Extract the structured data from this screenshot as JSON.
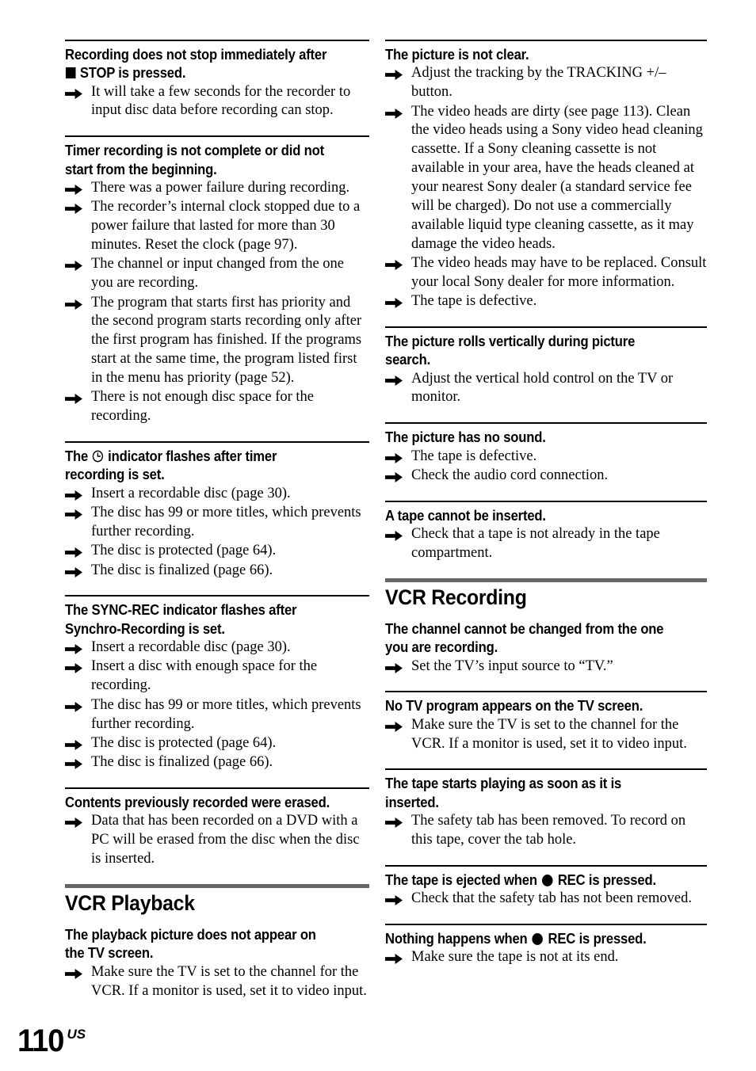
{
  "page": {
    "folio_number": "110",
    "folio_suffix": "US"
  },
  "left_column": {
    "blocks": [
      {
        "kind": "sub",
        "rule": "thin",
        "heading_parts": [
          {
            "type": "text",
            "value": "Recording does not stop immediately after "
          },
          {
            "type": "icon",
            "value": "stop-square-icon"
          },
          {
            "type": "text",
            "value": " STOP is pressed."
          }
        ],
        "heading_text": "Recording does not stop immediately after ■ STOP is pressed.",
        "bullets": [
          "It will take a few seconds for the recorder to input disc data before recording can stop."
        ]
      },
      {
        "kind": "sub",
        "rule": "thin",
        "heading_text": "Timer recording is not complete or did not start from the beginning.",
        "bullets": [
          "There was a power failure during recording.",
          "The recorder’s internal clock stopped due to a power failure that lasted for more than 30 minutes. Reset the clock (page 97).",
          "The channel or input changed from the one you are recording.",
          "The program that starts first has priority and the second program starts recording only after the first program has finished. If the programs start at the same time, the program listed first in the menu has priority (page 52).",
          "There is not enough disc space for the recording."
        ]
      },
      {
        "kind": "sub",
        "rule": "thin",
        "heading_parts": [
          {
            "type": "text",
            "value": "The "
          },
          {
            "type": "icon",
            "value": "timer-clock-icon"
          },
          {
            "type": "text",
            "value": " indicator flashes after timer recording is set."
          }
        ],
        "heading_text": "The ⊙ indicator flashes after timer recording is set.",
        "bullets": [
          "Insert a recordable disc (page 30).",
          "The disc has 99 or more titles, which prevents further recording.",
          "The disc is protected (page 64).",
          "The disc is finalized (page 66)."
        ]
      },
      {
        "kind": "sub",
        "rule": "thin",
        "heading_text": "The SYNC-REC indicator flashes after Synchro-Recording is set.",
        "bullets": [
          "Insert a recordable disc (page 30).",
          "Insert a disc with enough space for the recording.",
          "The disc has 99 or more titles, which prevents further recording.",
          "The disc is protected (page 64).",
          "The disc is finalized (page 66)."
        ]
      },
      {
        "kind": "sub",
        "rule": "thin",
        "heading_text": "Contents previously recorded were erased.",
        "bullets": [
          "Data that has been recorded on a DVD with a PC will be erased from the disc when the disc is inserted."
        ]
      },
      {
        "kind": "section",
        "rule": "section",
        "heading_text": "VCR Playback",
        "bullets": []
      },
      {
        "kind": "sub",
        "rule": "none",
        "heading_text": "The playback picture does not appear on the TV screen.",
        "bullets": [
          "Make sure the TV is set to the channel for the VCR. If a monitor is used, set it to video input."
        ]
      }
    ]
  },
  "right_column": {
    "blocks": [
      {
        "kind": "sub",
        "rule": "thin",
        "heading_text": "The picture is not clear.",
        "bullets": [
          "Adjust the tracking by the TRACKING +/– button.",
          "The video heads are dirty (see page 113). Clean the video heads using a Sony video head cleaning cassette. If a Sony cleaning cassette is not available in your area, have the heads cleaned at your nearest Sony dealer (a standard service fee will be charged). Do not use a commercially available liquid type cleaning cassette, as it may damage the video heads.",
          "The video heads may have to be replaced. Consult your local Sony dealer for more information.",
          "The tape is defective."
        ]
      },
      {
        "kind": "sub",
        "rule": "thin",
        "heading_text": "The picture rolls vertically during picture search.",
        "bullets": [
          "Adjust the vertical hold control on the TV or monitor."
        ]
      },
      {
        "kind": "sub",
        "rule": "thin",
        "heading_text": "The picture has no sound.",
        "bullets": [
          "The tape is defective.",
          "Check the audio cord connection."
        ]
      },
      {
        "kind": "sub",
        "rule": "thin",
        "heading_text": "A tape cannot be inserted.",
        "bullets": [
          "Check that a tape is not already in the tape compartment."
        ]
      },
      {
        "kind": "section",
        "rule": "section",
        "heading_text": "VCR Recording",
        "bullets": []
      },
      {
        "kind": "sub",
        "rule": "none",
        "heading_text": "The channel cannot be changed from the one you are recording.",
        "bullets": [
          "Set the TV’s input source to “TV.”"
        ]
      },
      {
        "kind": "sub",
        "rule": "thin",
        "heading_text": "No TV program appears on the TV screen.",
        "bullets": [
          "Make sure the TV is set to the channel for the VCR. If a monitor is used, set it to video input."
        ]
      },
      {
        "kind": "sub",
        "rule": "thin",
        "heading_text": "The tape starts playing as soon as it is inserted.",
        "bullets": [
          "The safety tab has been removed. To record on this tape, cover the tab hole."
        ]
      },
      {
        "kind": "sub",
        "rule": "thin",
        "heading_parts": [
          {
            "type": "text",
            "value": "The tape is ejected when "
          },
          {
            "type": "icon",
            "value": "rec-circle-icon"
          },
          {
            "type": "text",
            "value": " REC is pressed."
          }
        ],
        "heading_text": "The tape is ejected when ● REC is pressed.",
        "bullets": [
          "Check that the safety tab has not been removed."
        ]
      },
      {
        "kind": "sub",
        "rule": "thin",
        "heading_parts": [
          {
            "type": "text",
            "value": "Nothing happens when "
          },
          {
            "type": "icon",
            "value": "rec-circle-icon"
          },
          {
            "type": "text",
            "value": " REC is pressed."
          }
        ],
        "heading_text": "Nothing happens when ● REC is pressed.",
        "bullets": [
          "Make sure the tape is not at its end."
        ]
      }
    ]
  }
}
